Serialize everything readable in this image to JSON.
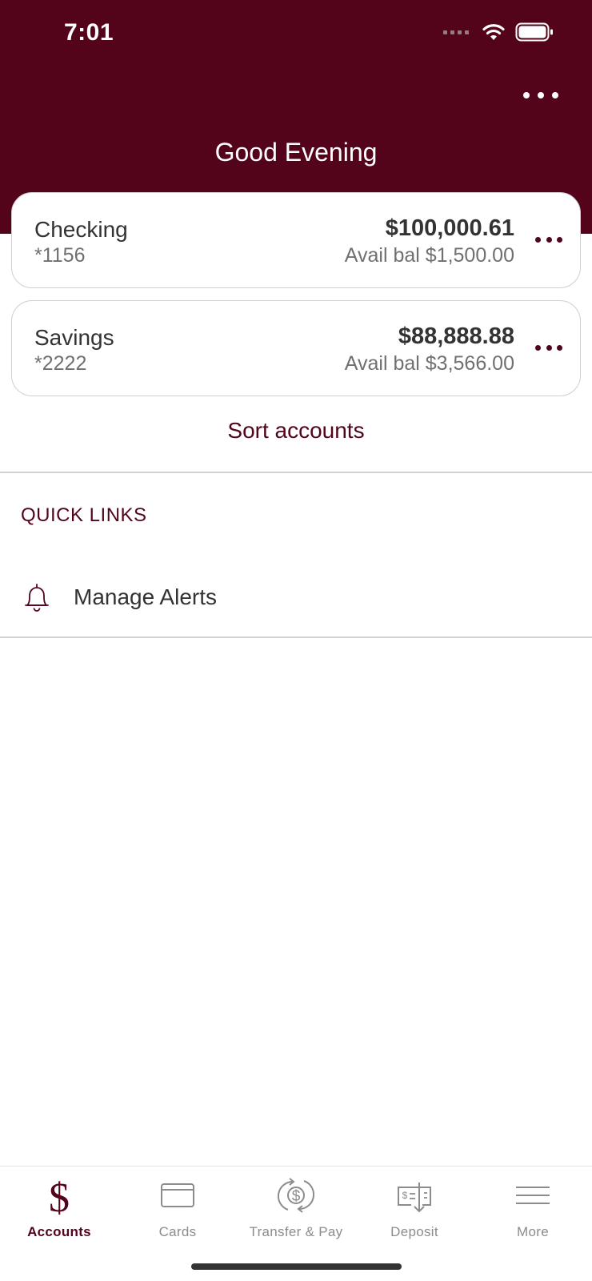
{
  "status_bar": {
    "time": "7:01",
    "icons": [
      "signal-dots-icon",
      "wifi-icon",
      "battery-icon"
    ]
  },
  "header": {
    "greeting": "Good Evening",
    "menu_icon": "ellipsis-icon"
  },
  "accounts": [
    {
      "name": "Checking",
      "number": "*1156",
      "balance": "$100,000.61",
      "available": "Avail bal $1,500.00"
    },
    {
      "name": "Savings",
      "number": "*2222",
      "balance": "$88,888.88",
      "available": "Avail bal $3,566.00"
    }
  ],
  "sort_accounts_label": "Sort accounts",
  "quick_links": {
    "title": "QUICK LINKS",
    "items": [
      {
        "label": "Manage Alerts",
        "icon": "bell-icon"
      }
    ]
  },
  "tabbar": {
    "tabs": [
      {
        "label": "Accounts",
        "icon": "dollar-icon",
        "active": true
      },
      {
        "label": "Cards",
        "icon": "card-icon",
        "active": false
      },
      {
        "label": "Transfer & Pay",
        "icon": "transfer-icon",
        "active": false
      },
      {
        "label": "Deposit",
        "icon": "check-deposit-icon",
        "active": false
      },
      {
        "label": "More",
        "icon": "menu-icon",
        "active": false
      }
    ]
  },
  "colors": {
    "brand": "#53041a",
    "text": "#333333",
    "muted": "#707070",
    "inactive_tab": "#8c8c8c"
  }
}
